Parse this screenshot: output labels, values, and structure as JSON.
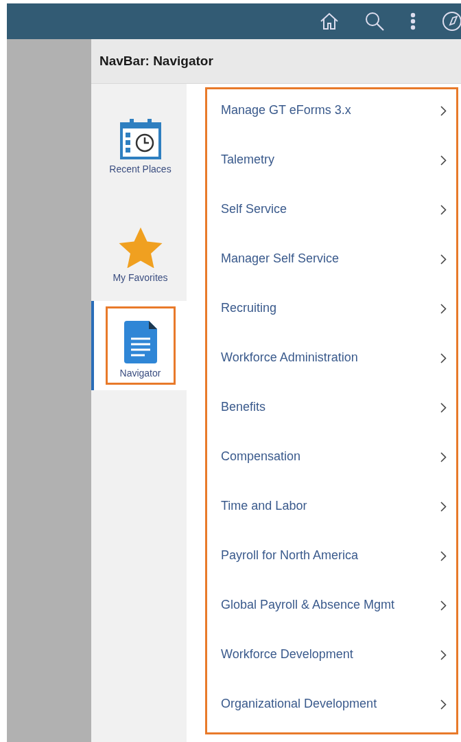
{
  "header": {
    "title": "NavBar: Navigator"
  },
  "tabs": [
    {
      "label": "Recent Places",
      "kind": "calendar",
      "selected": false
    },
    {
      "label": "My Favorites",
      "kind": "star",
      "selected": false
    },
    {
      "label": "Navigator",
      "kind": "document",
      "selected": true
    }
  ],
  "menu": {
    "items": [
      {
        "label": "Manage GT eForms 3.x"
      },
      {
        "label": "Talemetry"
      },
      {
        "label": "Self Service"
      },
      {
        "label": "Manager Self Service"
      },
      {
        "label": "Recruiting"
      },
      {
        "label": "Workforce Administration"
      },
      {
        "label": "Benefits"
      },
      {
        "label": "Compensation"
      },
      {
        "label": "Time and Labor"
      },
      {
        "label": "Payroll for North America"
      },
      {
        "label": "Global Payroll & Absence Mgmt"
      },
      {
        "label": "Workforce Development"
      },
      {
        "label": "Organizational Development"
      }
    ]
  }
}
